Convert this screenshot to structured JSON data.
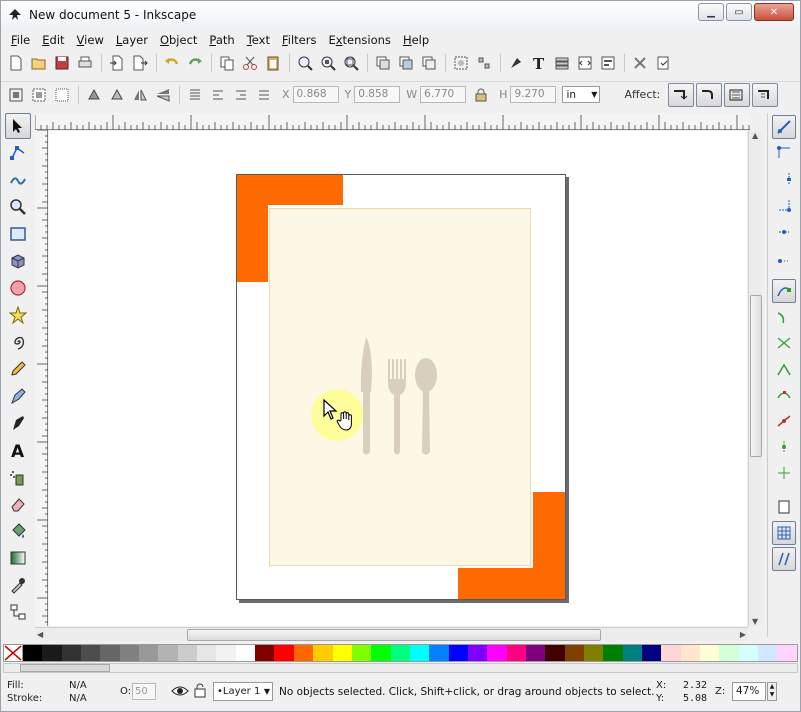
{
  "window": {
    "title": "New document 5 - Inkscape",
    "controls": {
      "minimize": "▁",
      "maximize": "▭",
      "close": "✕"
    }
  },
  "menu": [
    {
      "label": "File",
      "key": "F",
      "rest": "ile"
    },
    {
      "label": "Edit",
      "key": "E",
      "rest": "dit"
    },
    {
      "label": "View",
      "key": "V",
      "rest": "iew"
    },
    {
      "label": "Layer",
      "key": "L",
      "rest": "ayer"
    },
    {
      "label": "Object",
      "key": "O",
      "rest": "bject"
    },
    {
      "label": "Path",
      "key": "P",
      "rest": "ath"
    },
    {
      "label": "Text",
      "key": "T",
      "rest": "ext"
    },
    {
      "label": "Filters",
      "key": "F",
      "rest": "ilters"
    },
    {
      "label": "Extensions",
      "key": "x",
      "pre": "E",
      "rest": "tensions"
    },
    {
      "label": "Help",
      "key": "H",
      "rest": "elp"
    }
  ],
  "toolbar_controls": {
    "x_label": "X",
    "x_value": "0.868",
    "y_label": "Y",
    "y_value": "0.858",
    "w_label": "W",
    "w_value": "6.770",
    "h_label": "H",
    "h_value": "9.270",
    "unit": "in",
    "affect_label": "Affect:"
  },
  "status": {
    "fill_label": "Fill:",
    "fill_value": "N/A",
    "stroke_label": "Stroke:",
    "stroke_value": "N/A",
    "opacity_label": "O:",
    "opacity_value": "50",
    "layer": "•Layer 1",
    "message": "No objects selected. Click, Shift+click, or drag around objects to select.",
    "x_label": "X:",
    "x_value": "2.32",
    "y_label": "Y:",
    "y_value": "5.08",
    "zoom_label": "Z:",
    "zoom_value": "47%"
  },
  "colors": {
    "accent_orange": "#ff6a00",
    "panel_cream": "#fdf7e6",
    "cutlery": "#d9cfbd",
    "cursor_highlight": "#ffff80"
  },
  "palette": [
    "#000000",
    "#1a1a1a",
    "#333333",
    "#4d4d4d",
    "#666666",
    "#808080",
    "#999999",
    "#b3b3b3",
    "#cccccc",
    "#e6e6e6",
    "#f2f2f2",
    "#ffffff",
    "#800000",
    "#ff0000",
    "#ff6600",
    "#ffcc00",
    "#ffff00",
    "#80ff00",
    "#00ff00",
    "#00ff80",
    "#00ffff",
    "#0080ff",
    "#0000ff",
    "#8000ff",
    "#ff00ff",
    "#ff0080",
    "#800080",
    "#400000",
    "#804000",
    "#808000",
    "#008000",
    "#008080",
    "#000080",
    "#ffd5d5",
    "#ffe6cc",
    "#ffffd5",
    "#d5ffd5",
    "#d5ffff",
    "#d5e6ff",
    "#ffd5ff"
  ]
}
